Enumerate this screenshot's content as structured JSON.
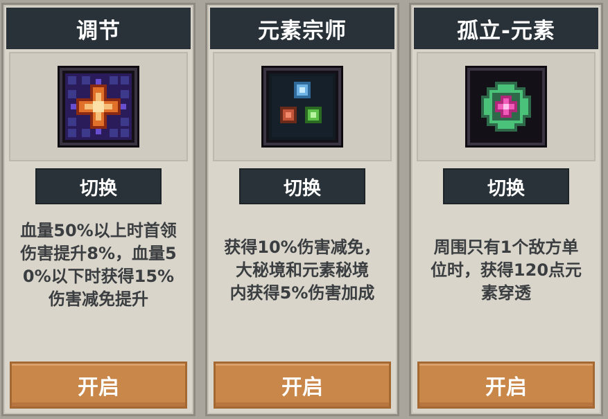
{
  "cards": [
    {
      "title": "调节",
      "icon": "orange-cross-icon",
      "switch_label": "切换",
      "description": "血量50%以上时首领\n伤害提升8%，血量5\n0%以下时获得15%\n伤害减免提升",
      "open_label": "开启"
    },
    {
      "title": "元素宗师",
      "icon": "three-element-orbs-icon",
      "switch_label": "切换",
      "description": "获得10%伤害减免，\n大秘境和元素秘境\n内获得5%伤害加成",
      "open_label": "开启"
    },
    {
      "title": "孤立-元素",
      "icon": "green-pink-gem-icon",
      "switch_label": "切换",
      "description": "周围只有1个敌方单\n位时，获得120点元\n素穿透",
      "open_label": "开启"
    }
  ],
  "colors": {
    "header_bg": "#283238",
    "card_bg": "#d9d5cb",
    "open_button": "#c9874a",
    "text": "#3b3e40"
  }
}
